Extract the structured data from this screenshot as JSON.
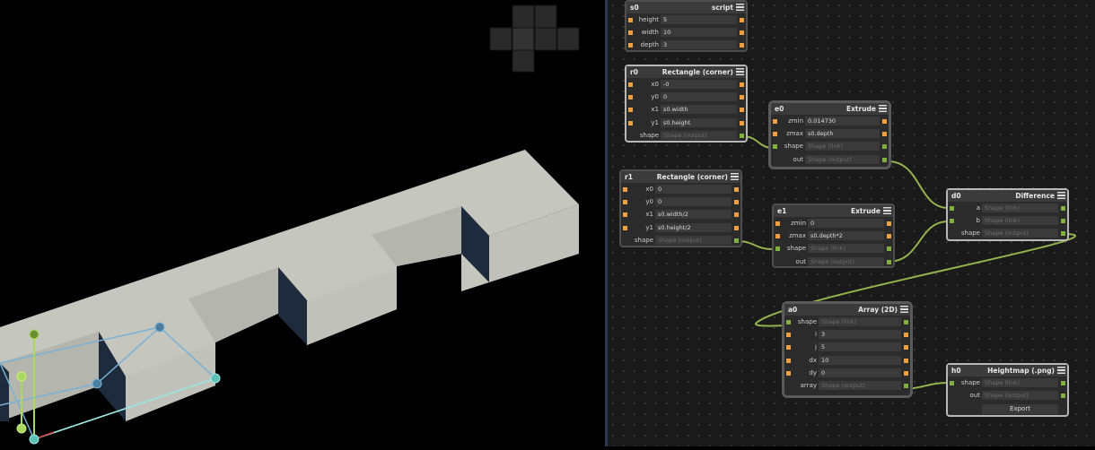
{
  "nodes": {
    "s0": {
      "id": "s0",
      "type": "script",
      "fields": [
        {
          "label": "height",
          "value": "5"
        },
        {
          "label": "width",
          "value": "10"
        },
        {
          "label": "depth",
          "value": "3"
        }
      ]
    },
    "r0": {
      "id": "r0",
      "type": "Rectangle (corner)",
      "fields": [
        {
          "label": "x0",
          "value": "-0"
        },
        {
          "label": "y0",
          "value": "0"
        },
        {
          "label": "x1",
          "value": "s0.width"
        },
        {
          "label": "y1",
          "value": "s0.height"
        },
        {
          "label": "shape",
          "value": "Shape (output)"
        }
      ]
    },
    "r1": {
      "id": "r1",
      "type": "Rectangle (corner)",
      "fields": [
        {
          "label": "x0",
          "value": "0"
        },
        {
          "label": "y0",
          "value": "0"
        },
        {
          "label": "x1",
          "value": "s0.width/2"
        },
        {
          "label": "y1",
          "value": "s0.height/2"
        },
        {
          "label": "shape",
          "value": "Shape (output)"
        }
      ]
    },
    "e0": {
      "id": "e0",
      "type": "Extrude",
      "fields": [
        {
          "label": "zmin",
          "value": "0.014730"
        },
        {
          "label": "zmax",
          "value": "s0.depth"
        },
        {
          "label": "shape",
          "value": "Shape (link)"
        },
        {
          "label": "out",
          "value": "Shape (output)"
        }
      ]
    },
    "e1": {
      "id": "e1",
      "type": "Extrude",
      "fields": [
        {
          "label": "zmin",
          "value": "0"
        },
        {
          "label": "zmax",
          "value": "s0.depth*2"
        },
        {
          "label": "shape",
          "value": "Shape (link)"
        },
        {
          "label": "out",
          "value": "Shape (output)"
        }
      ]
    },
    "d0": {
      "id": "d0",
      "type": "Difference",
      "fields": [
        {
          "label": "a",
          "value": "Shape (link)"
        },
        {
          "label": "b",
          "value": "Shape (link)"
        },
        {
          "label": "shape",
          "value": "Shape (output)"
        }
      ]
    },
    "a0": {
      "id": "a0",
      "type": "Array (2D)",
      "fields": [
        {
          "label": "shape",
          "value": "Shape (link)"
        },
        {
          "label": "i",
          "value": "3"
        },
        {
          "label": "j",
          "value": "5"
        },
        {
          "label": "dx",
          "value": "10"
        },
        {
          "label": "dy",
          "value": "0"
        },
        {
          "label": "array",
          "value": "Shape (output)"
        }
      ]
    },
    "h0": {
      "id": "h0",
      "type": "Heightmap (.png)",
      "fields": [
        {
          "label": "shape",
          "value": "Shape (link)"
        },
        {
          "label": "out",
          "value": "Shape (output)"
        }
      ],
      "button": "Export"
    }
  },
  "colors": {
    "port_value": "#f0a040",
    "port_shape": "#80b040",
    "wire": "#94b24e",
    "model_top": "#c5c6be",
    "model_side": "#1d2b3d",
    "selection": "#7ab0d4"
  }
}
